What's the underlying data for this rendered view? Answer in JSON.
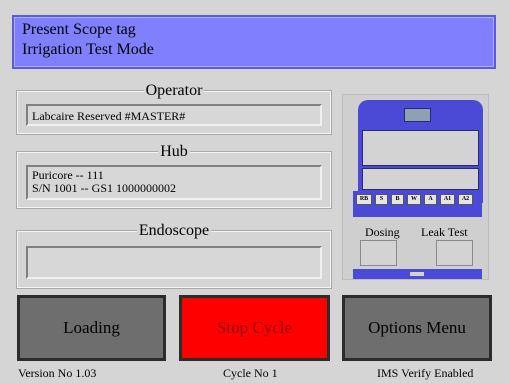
{
  "banner": {
    "line1": "Present Scope tag",
    "line2": "Irrigation Test Mode",
    "bg_color": "#8080ff"
  },
  "operator": {
    "title": "Operator",
    "value": "Labcaire Reserved #MASTER#"
  },
  "hub": {
    "title": "Hub",
    "line1": "Puricore -- 111",
    "line2": "S/N 1001 -- GS1 1000000002"
  },
  "endoscope": {
    "title": "Endoscope",
    "value": ""
  },
  "machine": {
    "buttons": [
      "RB",
      "S",
      "B",
      "W",
      "A",
      "A1",
      "A2"
    ],
    "dosing_label": "Dosing",
    "leak_label": "Leak Test",
    "accent_color": "#4a4ad6"
  },
  "actions": {
    "loading": "Loading",
    "stop_cycle": "Stop Cycle",
    "options_menu": "Options Menu",
    "stop_color": "#ff0000",
    "button_color": "#6e6e6e"
  },
  "status": {
    "version": "Version No 1.03",
    "cycle": "Cycle No 1",
    "ims": "IMS Verify Enabled"
  }
}
